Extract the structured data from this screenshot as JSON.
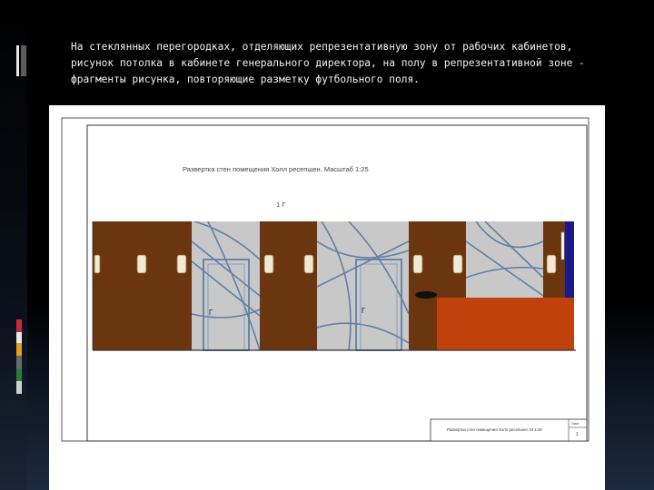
{
  "slide": {
    "caption_lines": [
      "На стеклянных перегородках, отделяющих репрезентативную зону от рабочих кабинетов,",
      "рисунок потолка в кабинете генерального директора, на полу в репрезентативной зоне -",
      "фрагменты рисунка, повторяющие разметку футбольного поля."
    ]
  },
  "drawing": {
    "title": "Развертка стен помещения Холл ресепшен. Масштаб 1:25",
    "level_mark": "1 Г",
    "door_mark_1": "Г",
    "door_mark_2": "Г",
    "stamp_text": "Развертка стен помещения Холл ресепшен. М 1:25",
    "stamp_sheet": "Лист",
    "stamp_number": "1"
  },
  "colors": {
    "wood": "#6b3510",
    "glass": "#c8c8c8",
    "glass_lines": "#5f7fa6",
    "desk": "#c0410c",
    "navy": "#1a1a8a",
    "handle": "#f0ead2",
    "accent_bars": [
      "#c8283c",
      "#e8e8e8",
      "#e0a020",
      "#5a5a5a",
      "#2a7a3a",
      "#d0d0d0"
    ]
  }
}
